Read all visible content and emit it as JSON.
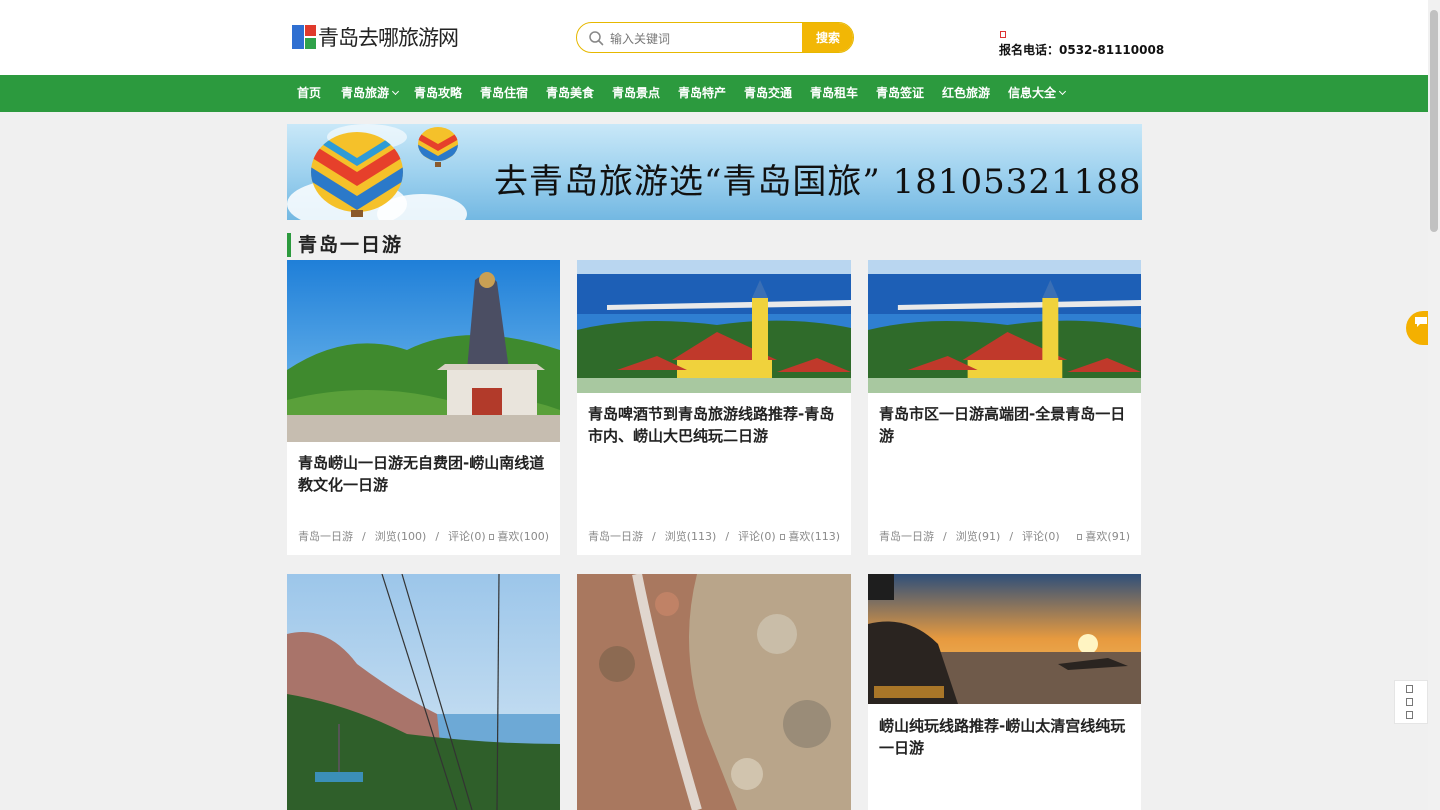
{
  "header": {
    "logo_text": "青岛去哪旅游网",
    "search": {
      "placeholder": "输入关键词",
      "button_label": "搜索"
    },
    "phone_text": "报名电话：0532-81110008"
  },
  "nav": {
    "items": [
      {
        "label": "首页",
        "dropdown": false
      },
      {
        "label": "青岛旅游",
        "dropdown": true
      },
      {
        "label": "青岛攻略",
        "dropdown": false
      },
      {
        "label": "青岛住宿",
        "dropdown": false
      },
      {
        "label": "青岛美食",
        "dropdown": false
      },
      {
        "label": "青岛景点",
        "dropdown": false
      },
      {
        "label": "青岛特产",
        "dropdown": false
      },
      {
        "label": "青岛交通",
        "dropdown": false
      },
      {
        "label": "青岛租车",
        "dropdown": false
      },
      {
        "label": "青岛签证",
        "dropdown": false
      },
      {
        "label": "红色旅游",
        "dropdown": false
      },
      {
        "label": "信息大全",
        "dropdown": true
      }
    ]
  },
  "banner": {
    "text": "去青岛旅游选“青岛国旅” 18105321188"
  },
  "section": {
    "title": "青岛一日游"
  },
  "cards": [
    {
      "title": "青岛崂山一日游无自费团-崂山南线道教文化一日游",
      "category": "青岛一日游",
      "views": "浏览(100)",
      "comments": "评论(0)",
      "likes": "喜欢(100)"
    },
    {
      "title": "青岛啤酒节到青岛旅游线路推荐-青岛市内、崂山大巴纯玩二日游",
      "category": "青岛一日游",
      "views": "浏览(113)",
      "comments": "评论(0)",
      "likes": "喜欢(113)"
    },
    {
      "title": "青岛市区一日游高端团-全景青岛一日游",
      "category": "青岛一日游",
      "views": "浏览(91)",
      "comments": "评论(0)",
      "likes": "喜欢(91)"
    },
    {
      "title": ""
    },
    {
      "title": ""
    },
    {
      "title": "崂山纯玩线路推荐-崂山太清宫线纯玩一日游"
    }
  ],
  "colors": {
    "nav_green": "#2c9a3e",
    "search_yellow": "#f2b705",
    "consult_orange": "#f4b000"
  },
  "icons": [
    "search-icon",
    "chevron-down-icon",
    "phone-icon",
    "heart-icon",
    "chat-icon",
    "back-to-top-icon"
  ]
}
